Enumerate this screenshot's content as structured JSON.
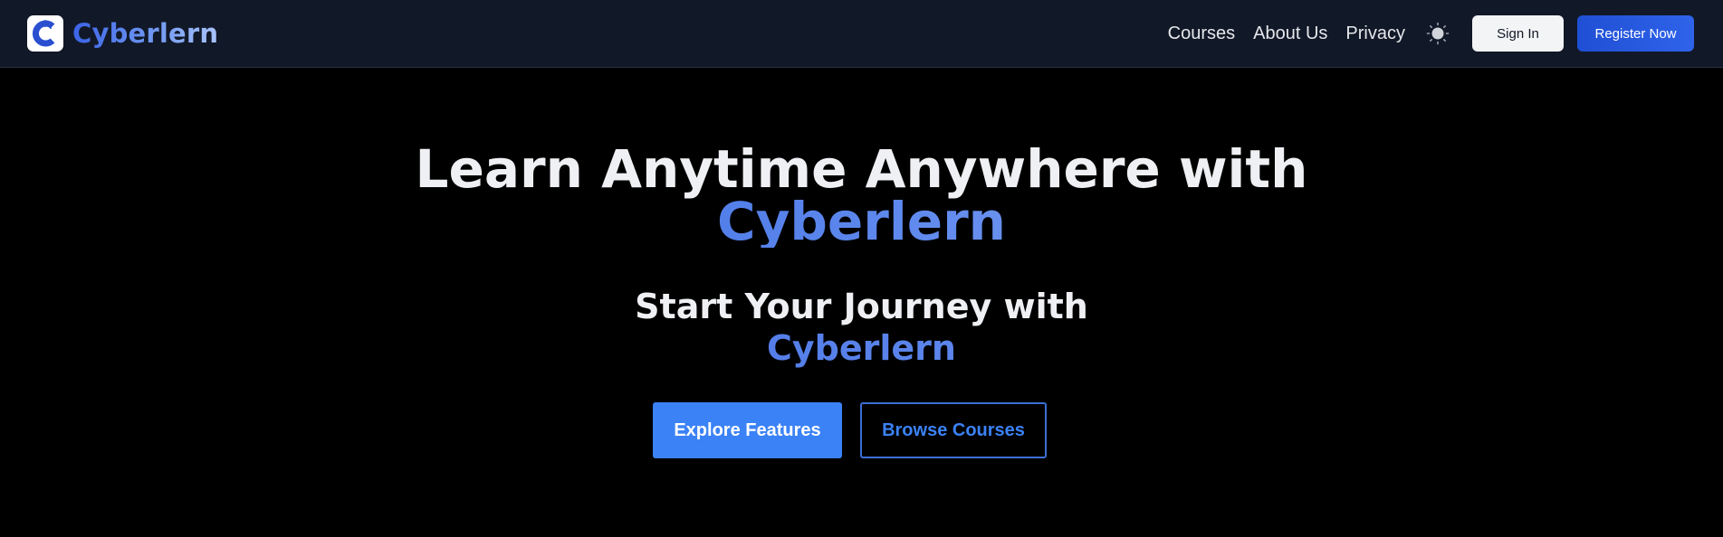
{
  "brand": {
    "name": "Cyberlern",
    "logo_icon": "cyberlern-c-graduation-cap-logo"
  },
  "nav": {
    "links": [
      {
        "label": "Courses"
      },
      {
        "label": "About Us"
      },
      {
        "label": "Privacy"
      }
    ],
    "theme_toggle_icon": "sun-icon",
    "sign_in_label": "Sign In",
    "register_label": "Register Now"
  },
  "hero": {
    "title_line1": "Learn Anytime Anywhere with",
    "title_highlight": "Cyberlern",
    "subtitle_line1": "Start Your Journey with",
    "subtitle_highlight": "Cyberlern",
    "explore_label": "Explore Features",
    "browse_label": "Browse Courses"
  },
  "colors": {
    "nav_bg": "#111827",
    "page_bg": "#000000",
    "accent_blue": "#3b82f6",
    "register_blue": "#2563eb",
    "text_light": "#eef0f3"
  }
}
